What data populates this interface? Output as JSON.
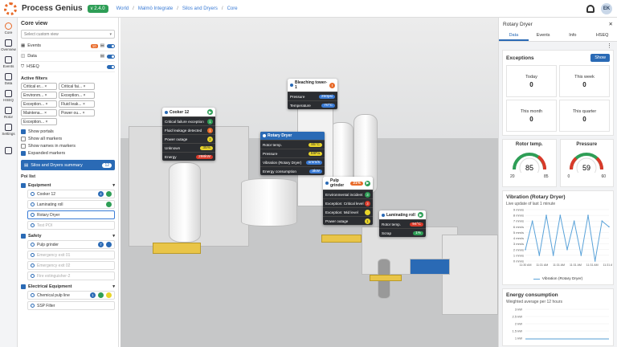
{
  "app": {
    "name": "Process Genius",
    "version": "v 2.4.0"
  },
  "breadcrumb": [
    "World",
    "Malmö Integrate",
    "Silos and Dryers",
    "Core"
  ],
  "user": {
    "initials": "EK"
  },
  "rail": [
    {
      "label": "Core"
    },
    {
      "label": "Overview"
    },
    {
      "label": "Events"
    },
    {
      "label": "Data"
    },
    {
      "label": "HSEQ"
    },
    {
      "label": "Rotor"
    },
    {
      "label": "Settings"
    }
  ],
  "core": {
    "title": "Core view",
    "select_placeholder": "Select custom view",
    "layers": [
      {
        "label": "Events",
        "badge": "10"
      },
      {
        "label": "Data"
      },
      {
        "label": "HSEQ"
      }
    ],
    "active_filters_title": "Active filters",
    "filters": [
      "Critical er...",
      "Critical fai...",
      "Environm...",
      "Exception...",
      "Exception...",
      "Fluid leak...",
      "Maintena...",
      "Power ou...",
      "Exception..."
    ],
    "options": [
      {
        "label": "Show portals",
        "on": true
      },
      {
        "label": "Show all markers",
        "on": false
      },
      {
        "label": "Show names in markers",
        "on": false
      },
      {
        "label": "Expanded markers",
        "on": true
      }
    ],
    "summary": {
      "label": "Silos and Dryers summary",
      "count": "12"
    },
    "poi_list_title": "Poi list",
    "groups": [
      {
        "name": "Equipment",
        "items": [
          {
            "name": "Cooker 12",
            "badge": "4"
          },
          {
            "name": "Laminating roll"
          },
          {
            "name": "Rotary Dryer"
          },
          {
            "name": "Test POI"
          }
        ]
      },
      {
        "name": "Safety",
        "items": [
          {
            "name": "Pulp grinder",
            "badge": "7"
          },
          {
            "name": "Emergency exit 01"
          },
          {
            "name": "Emergency exit 02"
          },
          {
            "name": "Fire extinguisher-2"
          }
        ]
      },
      {
        "name": "Electrical Equipment",
        "items": [
          {
            "name": "Chemical pulp line",
            "badge": "1"
          },
          {
            "name": "SSP Filter"
          }
        ]
      }
    ]
  },
  "cards": {
    "cooker": {
      "title": "Cooker 12",
      "rows": [
        {
          "k": "Critical failure exception",
          "v": "1"
        },
        {
          "k": "Fluid leakage detected",
          "v": "1"
        },
        {
          "k": "Power outage",
          "v": "2"
        },
        {
          "k": "Unknown",
          "v": "35%"
        },
        {
          "k": "Energy",
          "v": "298kW"
        }
      ]
    },
    "bleaching": {
      "title": "Bleaching tower-1",
      "badge": "!",
      "rows": [
        {
          "k": "Pressure",
          "v": "250psi"
        },
        {
          "k": "Temperature",
          "v": "70°C"
        }
      ]
    },
    "rotary": {
      "title": "Rotary Dryer",
      "rows": [
        {
          "k": "Rotor temp.",
          "v": "85°C"
        },
        {
          "k": "Pressure",
          "v": "59Pa"
        },
        {
          "k": "Vibration (Rotary Dryer)",
          "v": "1mm/s"
        },
        {
          "k": "Energy consumption",
          "v": "3kW"
        }
      ]
    },
    "pulp": {
      "title": "Pulp grinder",
      "pct": "21%",
      "rows": [
        {
          "k": "Environmental incident",
          "v": "3"
        },
        {
          "k": "Exception: Critical level",
          "v": "3"
        },
        {
          "k": "Exception: Mid level",
          "v": ""
        },
        {
          "k": "Power outage",
          "v": "1"
        }
      ]
    },
    "lamroll": {
      "title": "Laminating roll",
      "rows": [
        {
          "k": "Rotor temp.",
          "v": "94°C"
        },
        {
          "k": "Scrap",
          "v": "1%"
        }
      ]
    }
  },
  "right": {
    "title": "Rotary Dryer",
    "tabs": [
      "Data",
      "Events",
      "Info",
      "HSEQ"
    ],
    "exceptions": {
      "title": "Exceptions",
      "show": "Show",
      "cells": [
        {
          "label": "Today",
          "value": "0"
        },
        {
          "label": "This week",
          "value": "0"
        },
        {
          "label": "This month",
          "value": "0"
        },
        {
          "label": "This quarter",
          "value": "0"
        }
      ]
    },
    "gauges": [
      {
        "title": "Rotor temp.",
        "value": 85,
        "min": "20",
        "max": "85"
      },
      {
        "title": "Pressure",
        "value": 59,
        "min": "0",
        "max": "60"
      }
    ],
    "vibration": {
      "title": "Vibration (Rotary Dryer)",
      "subtitle": "Live update of last 1 minute",
      "legend": "Vibration (Rotary Dryer)"
    },
    "energy": {
      "title": "Energy consumption",
      "subtitle": "Weighted average per 12 hours",
      "yticks": [
        "3 kW",
        "2.5 kW",
        "2 kW",
        "1.5 kW",
        "1 kW"
      ]
    }
  },
  "chart_data": {
    "type": "line",
    "title": "Vibration (Rotary Dryer)",
    "x": [
      "11:30 AM",
      "11:31 AM",
      "11:31 AM",
      "11:31 AM",
      "11:31 AM",
      "11:31 AM"
    ],
    "y_ticks": [
      "9 mm/s",
      "8 mm/s",
      "7 mm/s",
      "6 mm/s",
      "5 mm/s",
      "4 mm/s",
      "3 mm/s",
      "2 mm/s",
      "1 mm/s",
      "0 mm/s"
    ],
    "ylim": [
      0,
      9
    ],
    "series": [
      {
        "name": "Vibration (Rotary Dryer)",
        "values": [
          2,
          7,
          1,
          8,
          1,
          8,
          2,
          7,
          1,
          8,
          0,
          7,
          6
        ]
      }
    ]
  }
}
